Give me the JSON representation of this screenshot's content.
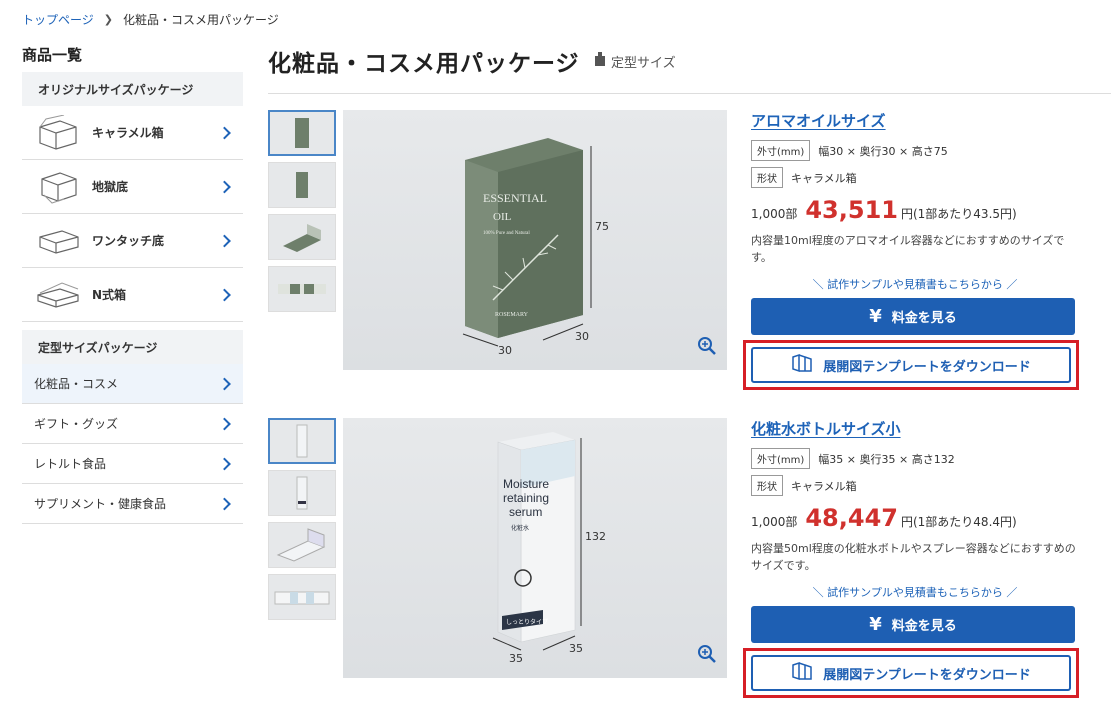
{
  "breadcrumb": {
    "home": "トップページ",
    "current": "化粧品・コスメ用パッケージ"
  },
  "sidebar": {
    "title": "商品一覧",
    "group1": "オリジナルサイズパッケージ",
    "items": [
      {
        "label": "キャラメル箱"
      },
      {
        "label": "地獄底"
      },
      {
        "label": "ワンタッチ底"
      },
      {
        "label": "N式箱"
      }
    ],
    "group2": "定型サイズパッケージ",
    "items2": [
      {
        "label": "化粧品・コスメ"
      },
      {
        "label": "ギフト・グッズ"
      },
      {
        "label": "レトルト食品"
      },
      {
        "label": "サプリメント・健康食品"
      }
    ]
  },
  "page": {
    "title": "化粧品・コスメ用パッケージ",
    "tag": "定型サイズ"
  },
  "products": [
    {
      "name": "アロマオイルサイズ",
      "size_pill": "外寸(mm)",
      "size": "幅30 × 奥行30 × 高さ75",
      "shape_pill": "形状",
      "shape": "キャラメル箱",
      "qty": "1,000部",
      "price": "43,511",
      "unit": "円(1部あたり43.5円)",
      "desc": "内容量10ml程度のアロマオイル容器などにおすすめのサイズです。",
      "sample": "＼ 試作サンプルや見積書もこちらから ／",
      "btn_price": "料金を見る",
      "btn_download": "展開図テンプレートをダウンロード",
      "dim_h": "75",
      "dim_w": "30",
      "dim_d": "30",
      "box_text1": "ESSENTIAL",
      "box_text2": "OIL",
      "box_text3": "100% Pure and Natural",
      "box_text4": "ROSEMARY"
    },
    {
      "name": "化粧水ボトルサイズ小",
      "size_pill": "外寸(mm)",
      "size": "幅35 × 奥行35 × 高さ132",
      "shape_pill": "形状",
      "shape": "キャラメル箱",
      "qty": "1,000部",
      "price": "48,447",
      "unit": "円(1部あたり48.4円)",
      "desc": "内容量50ml程度の化粧水ボトルやスプレー容器などにおすすめのサイズです。",
      "sample": "＼ 試作サンプルや見積書もこちらから ／",
      "btn_price": "料金を見る",
      "btn_download": "展開図テンプレートをダウンロード",
      "dim_h": "132",
      "dim_w": "35",
      "dim_d": "35",
      "box_text1": "Moisture",
      "box_text2": "retaining",
      "box_text3": "serum",
      "box_text4": "化粧水",
      "box_text5": "しっとりタイプ"
    }
  ]
}
